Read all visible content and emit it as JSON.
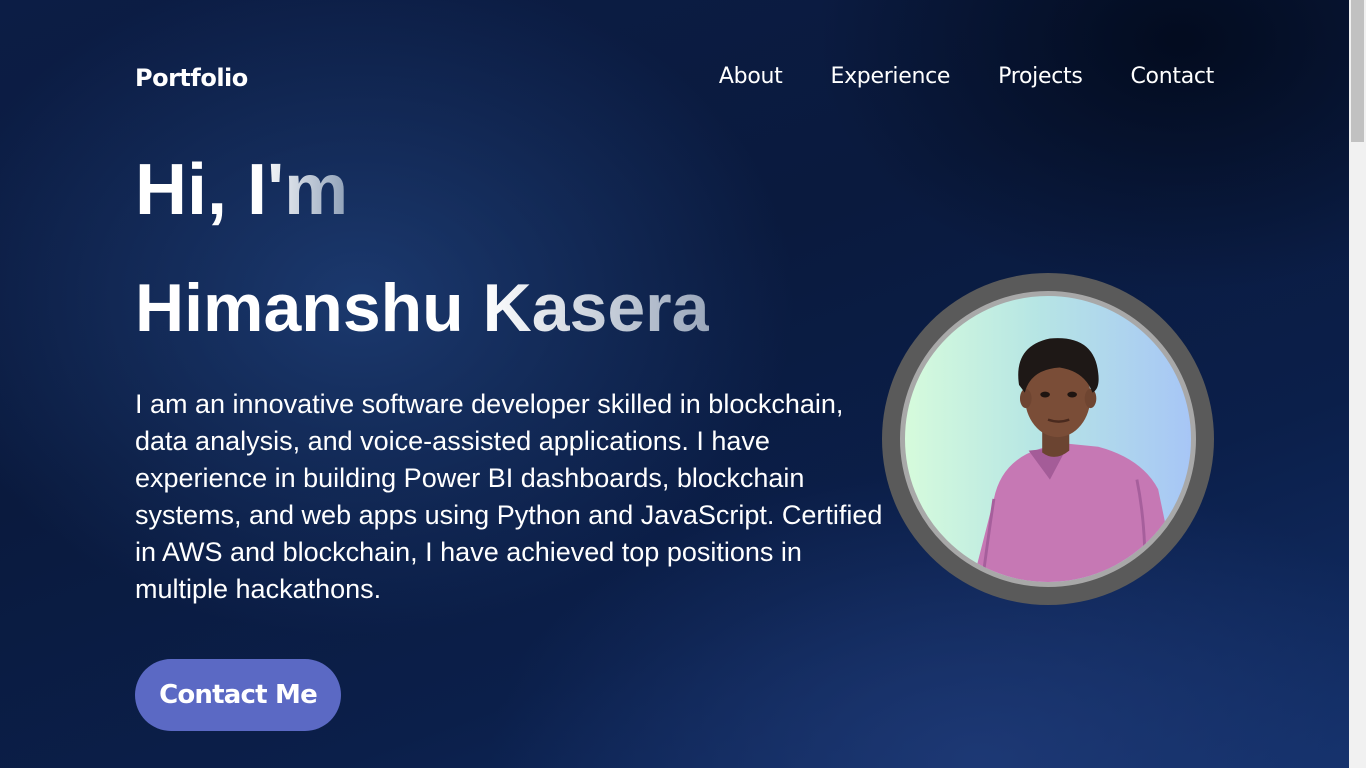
{
  "nav": {
    "brand": "Portfolio",
    "links": [
      {
        "label": "About"
      },
      {
        "label": "Experience"
      },
      {
        "label": "Projects"
      },
      {
        "label": "Contact"
      }
    ]
  },
  "hero": {
    "greeting": "Hi, I'm",
    "name": "Himanshu Kasera",
    "description": "I am an innovative software developer skilled in blockchain, data analysis, and voice-assisted applications. I have experience in building Power BI dashboards, blockchain systems, and web apps using Python and JavaScript. Certified in AWS and blockchain, I have achieved top positions in multiple hackathons.",
    "cta_label": "Contact Me"
  },
  "colors": {
    "background": "#0c1d45",
    "accent": "#5b69c4",
    "ring": "#5a5a5a"
  }
}
